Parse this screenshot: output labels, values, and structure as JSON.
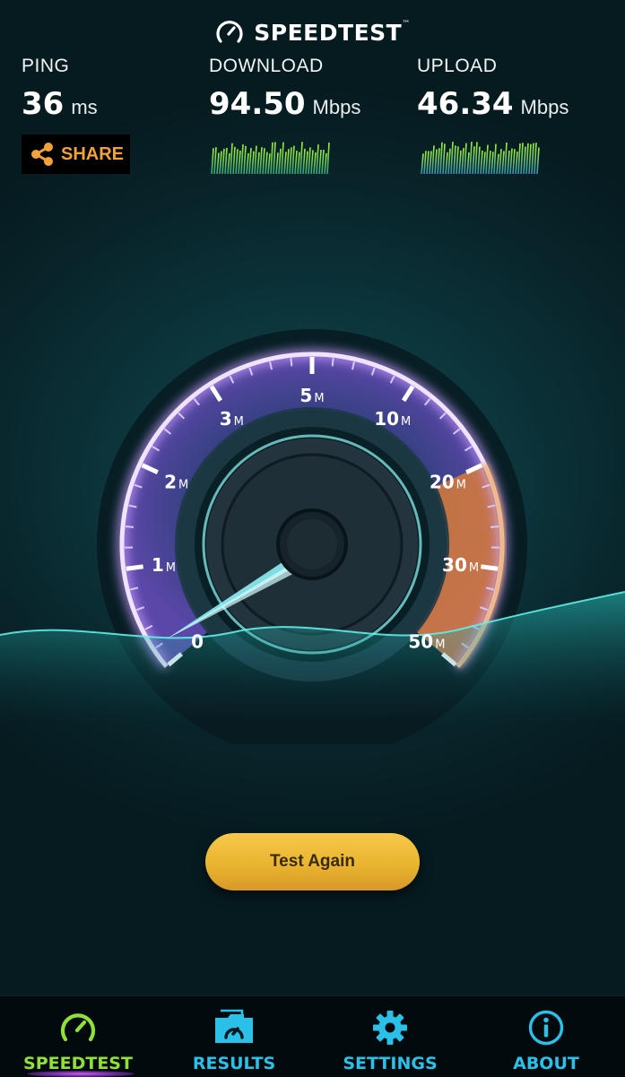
{
  "header": {
    "title": "SPEEDTEST",
    "tm": "™"
  },
  "stats": {
    "ping": {
      "label": "PING",
      "value": "36",
      "unit": "ms"
    },
    "download": {
      "label": "DOWNLOAD",
      "value": "94.50",
      "unit": "Mbps"
    },
    "upload": {
      "label": "UPLOAD",
      "value": "46.34",
      "unit": "Mbps"
    }
  },
  "share": {
    "label": "SHARE",
    "icon": "share-icon"
  },
  "gauge": {
    "ticks": [
      {
        "num": "0",
        "suffix": ""
      },
      {
        "num": "1",
        "suffix": "M"
      },
      {
        "num": "2",
        "suffix": "M"
      },
      {
        "num": "3",
        "suffix": "M"
      },
      {
        "num": "5",
        "suffix": "M"
      },
      {
        "num": "10",
        "suffix": "M"
      },
      {
        "num": "20",
        "suffix": "M"
      },
      {
        "num": "30",
        "suffix": "M"
      },
      {
        "num": "50",
        "suffix": "M"
      }
    ],
    "colors": {
      "arc": "#b58cff",
      "fill": "#4a3f9a",
      "highlight": "#d87b3a",
      "needle": "#8ff0f6"
    }
  },
  "actions": {
    "test_again": "Test Again"
  },
  "nav": {
    "items": [
      {
        "label": "SPEEDTEST",
        "icon": "speedometer-icon",
        "active": true
      },
      {
        "label": "RESULTS",
        "icon": "results-folder-icon",
        "active": false
      },
      {
        "label": "SETTINGS",
        "icon": "gear-icon",
        "active": false
      },
      {
        "label": "ABOUT",
        "icon": "info-icon",
        "active": false
      }
    ],
    "active_color": "#8fe03a",
    "inactive_color": "#2bc0e8"
  }
}
